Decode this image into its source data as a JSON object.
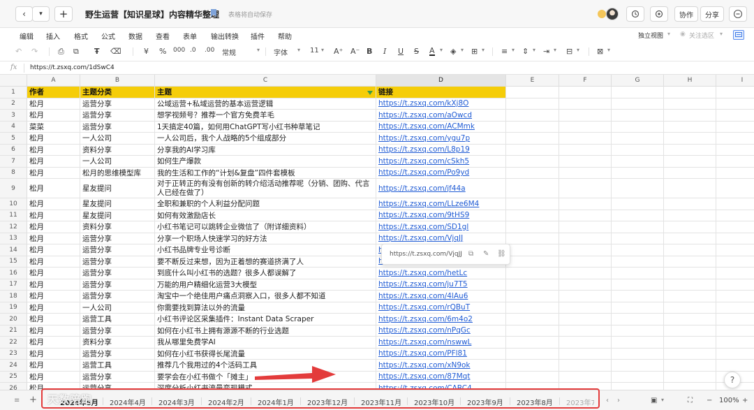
{
  "titlebar": {
    "back": "‹",
    "dropdown": "▾",
    "new": "+",
    "title": "野生运营【知识星球】内容精华整理",
    "autosave": "表格将自动保存",
    "history_icon": "history-icon",
    "collaborate": "协作",
    "share": "分享"
  },
  "menu": {
    "items": [
      "编辑",
      "插入",
      "格式",
      "公式",
      "数据",
      "查看",
      "表单",
      "输出转换",
      "插件",
      "帮助"
    ],
    "standalone": "独立视图",
    "focus_area": "关注选区"
  },
  "toolbar": {
    "currency": "¥",
    "percent": "%",
    "thousands": "000",
    "decimal_inc": ".0",
    "decimal_dec": ".00",
    "number_format": "常规",
    "font": "字体",
    "font_size": "11",
    "grow": "A⁺",
    "shrink": "A⁻",
    "bold": "B",
    "italic": "I",
    "underline": "U",
    "strike": "S",
    "font_color": "A"
  },
  "formula": {
    "fx": "fx",
    "value": "https://t.zsxq.com/1dSwC4"
  },
  "columns": [
    "A",
    "B",
    "C",
    "D",
    "E",
    "F",
    "G",
    "H",
    "I"
  ],
  "header_row": {
    "num": "1",
    "a": "作者",
    "b": "主题分类",
    "c": "主题",
    "d": "链接"
  },
  "rows": [
    {
      "num": "2",
      "a": "松月",
      "b": "运营分享",
      "c": "公域运营+私域运营的基本运营逻辑",
      "d": "https://t.zsxq.com/kXj8O"
    },
    {
      "num": "3",
      "a": "松月",
      "b": "运营分享",
      "c": "想学视频号？推荐一个官方免费羊毛",
      "d": "https://t.zsxq.com/aOwcd"
    },
    {
      "num": "4",
      "a": "菜菜",
      "b": "运营分享",
      "c": "1天搞定40篇，如何用ChatGPT写小红书种草笔记",
      "d": "https://t.zsxq.com/ACMmk"
    },
    {
      "num": "5",
      "a": "松月",
      "b": "一人公司",
      "c": "一人公司后，我个人战略的5个组成部分",
      "d": "https://t.zsxq.com/ygu7p"
    },
    {
      "num": "6",
      "a": "松月",
      "b": "资料分享",
      "c": "分享我的AI学习库",
      "d": "https://t.zsxq.com/L8p19"
    },
    {
      "num": "7",
      "a": "松月",
      "b": "一人公司",
      "c": "如何生产爆款",
      "d": "https://t.zsxq.com/cSkh5"
    },
    {
      "num": "8",
      "a": "松月",
      "b": "松月的思维模型库",
      "c": "我的生活和工作的“计划&复盘”四件套模板",
      "d": "https://t.zsxq.com/Po9yd"
    },
    {
      "num": "9",
      "a": "松月",
      "b": "星友提问",
      "c": "对于正转正的有没有创新的转介绍活动推荐呢（分销、团购、代言人已经在做了）",
      "d": "https://t.zsxq.com/jf44a"
    },
    {
      "num": "10",
      "a": "松月",
      "b": "星友提问",
      "c": "全职和兼职的个人利益分配问题",
      "d": "https://t.zsxq.com/LLze6M4"
    },
    {
      "num": "11",
      "a": "松月",
      "b": "星友提问",
      "c": "如何有效激励店长",
      "d": "https://t.zsxq.com/9tHS9"
    },
    {
      "num": "12",
      "a": "松月",
      "b": "资料分享",
      "c": "小红书笔记可以跳转企业微信了（附详细资料）",
      "d": "https://t.zsxq.com/SD1gl"
    },
    {
      "num": "13",
      "a": "松月",
      "b": "运营分享",
      "c": "分享一个职场人快速学习的好方法",
      "d": "https://t.zsxq.com/VjqJJ"
    },
    {
      "num": "14",
      "a": "松月",
      "b": "运营分享",
      "c": "小红书品牌专业号诊断",
      "d": "h"
    },
    {
      "num": "15",
      "a": "松月",
      "b": "运营分享",
      "c": "要不断反过来想，因为正着想的赛道挤满了人",
      "d": "h"
    },
    {
      "num": "16",
      "a": "松月",
      "b": "运营分享",
      "c": "到底什么叫小红书的选题？很多人都误解了",
      "d": "https://t.zsxq.com/hetLc"
    },
    {
      "num": "17",
      "a": "松月",
      "b": "运营分享",
      "c": "万能的用户精细化运营3大模型",
      "d": "https://t.zsxq.com/ju7T5"
    },
    {
      "num": "18",
      "a": "松月",
      "b": "运营分享",
      "c": "淘宝中一个绝佳用户痛点洞察入口，很多人都不知道",
      "d": "https://t.zsxq.com/4lAu6"
    },
    {
      "num": "19",
      "a": "松月",
      "b": "一人公司",
      "c": "你需要找到算法以外的流量",
      "d": "https://t.zsxq.com/rQBuT"
    },
    {
      "num": "20",
      "a": "松月",
      "b": "运营工具",
      "c": "小红书评论区采集插件：Instant Data Scraper",
      "d": "https://t.zsxq.com/6m4o2"
    },
    {
      "num": "21",
      "a": "松月",
      "b": "运营分享",
      "c": "如何在小红书上拥有源源不断的行业选题",
      "d": "https://t.zsxq.com/nPqGc"
    },
    {
      "num": "22",
      "a": "松月",
      "b": "资料分享",
      "c": "我从哪里免费学AI",
      "d": "https://t.zsxq.com/nswwL"
    },
    {
      "num": "23",
      "a": "松月",
      "b": "运营分享",
      "c": "如何在小红书获得长尾流量",
      "d": "https://t.zsxq.com/PFl81"
    },
    {
      "num": "24",
      "a": "松月",
      "b": "运营工具",
      "c": "推荐几个我用过的4个活码工具",
      "d": "https://t.zsxq.com/xN9ok"
    },
    {
      "num": "25",
      "a": "松月",
      "b": "运营分享",
      "c": "要学会在小红书做个「摊主」",
      "d": "https://t.zsxq.com/87Mqt"
    },
    {
      "num": "26",
      "a": "松月",
      "b": "运营分享",
      "c": "深度分析小红书流量变现模式",
      "d": "https://t.zsxq.com/CABC4"
    }
  ],
  "popup": {
    "url": "https://t.zsxq.com/VjqJJ"
  },
  "sheet_tabs": [
    "2024年5月",
    "2024年4月",
    "2024年3月",
    "2024年2月",
    "2024年1月",
    "2023年12月",
    "2023年11月",
    "2023年10月",
    "2023年9月",
    "2023年8月",
    "2023年7"
  ],
  "zoom": "100%",
  "watermark": "天数陪跑",
  "help": "?",
  "colors": {
    "header_fill": "#f5cd09",
    "link": "#1f5bd4",
    "annotation": "#e33b3b"
  }
}
